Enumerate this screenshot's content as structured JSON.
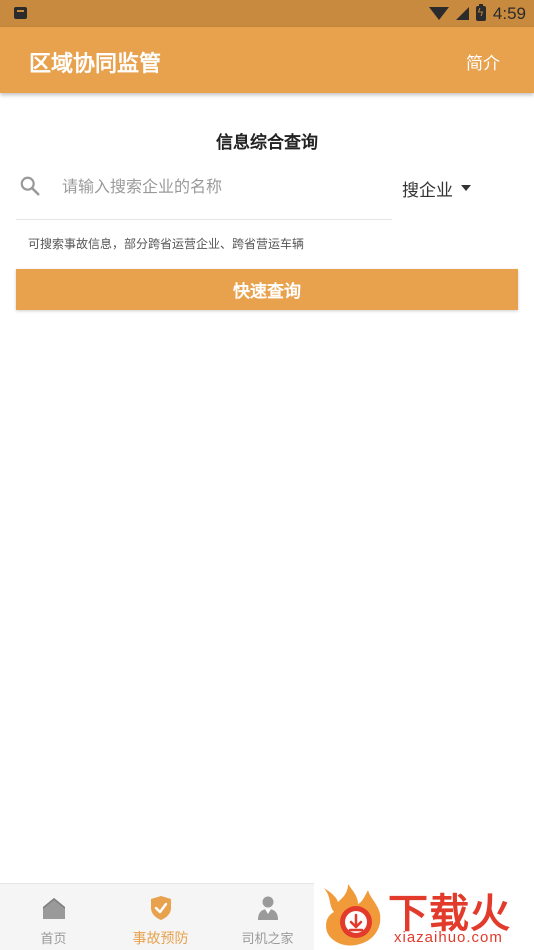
{
  "status_bar": {
    "time": "4:59"
  },
  "app_bar": {
    "title": "区域协同监管",
    "action_label": "简介"
  },
  "search": {
    "section_title": "信息综合查询",
    "placeholder": "请输入搜索企业的名称",
    "type_label": "搜企业",
    "hint": "可搜索事故信息，部分跨省运营企业、跨省营运车辆",
    "button_label": "快速查询"
  },
  "bottom_nav": {
    "items": [
      {
        "label": "首页",
        "icon": "home-icon",
        "active": false
      },
      {
        "label": "事故预防",
        "icon": "shield-check-icon",
        "active": true
      },
      {
        "label": "司机之家",
        "icon": "driver-icon",
        "active": false
      }
    ]
  },
  "watermark": {
    "brand": "下载火",
    "domain": "xiazaihuo.com"
  },
  "colors": {
    "accent": "#e8a24e",
    "status_bar": "#c88a3e",
    "watermark": "#e23b2b"
  }
}
